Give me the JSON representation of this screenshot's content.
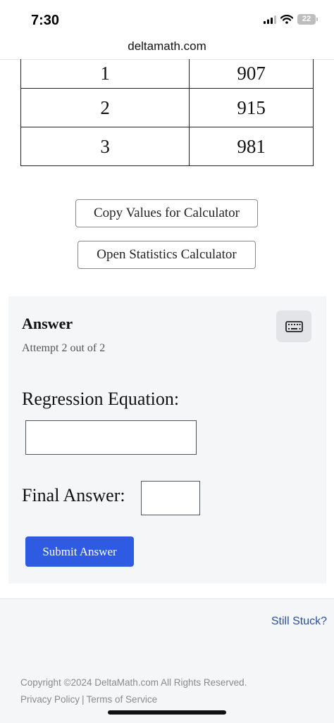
{
  "status_bar": {
    "time": "7:30",
    "battery_level": "22",
    "icons": [
      "cellular-signal-icon",
      "wifi-icon",
      "battery-icon"
    ]
  },
  "browser": {
    "url": "deltamath.com"
  },
  "table": {
    "rows": [
      [
        "1",
        "907"
      ],
      [
        "2",
        "915"
      ],
      [
        "3",
        "981"
      ]
    ]
  },
  "buttons": {
    "copy_values": "Copy Values for Calculator",
    "open_stats": "Open Statistics Calculator"
  },
  "answer": {
    "title": "Answer",
    "attempt": "Attempt 2 out of 2",
    "keyboard_icon": "keyboard-icon",
    "regression_label": "Regression Equation:",
    "regression_value": "",
    "final_label": "Final Answer:",
    "final_value": "",
    "submit_label": "Submit Answer"
  },
  "footer": {
    "still_stuck": "Still Stuck?",
    "copyright": "Copyright ©2024 DeltaMath.com All Rights Reserved.",
    "privacy": "Privacy Policy",
    "separator": "|",
    "terms": "Terms of Service"
  },
  "colors": {
    "primary_button": "#2f5be3",
    "link": "#2a4f9e",
    "card_background": "#f4f6f8"
  }
}
